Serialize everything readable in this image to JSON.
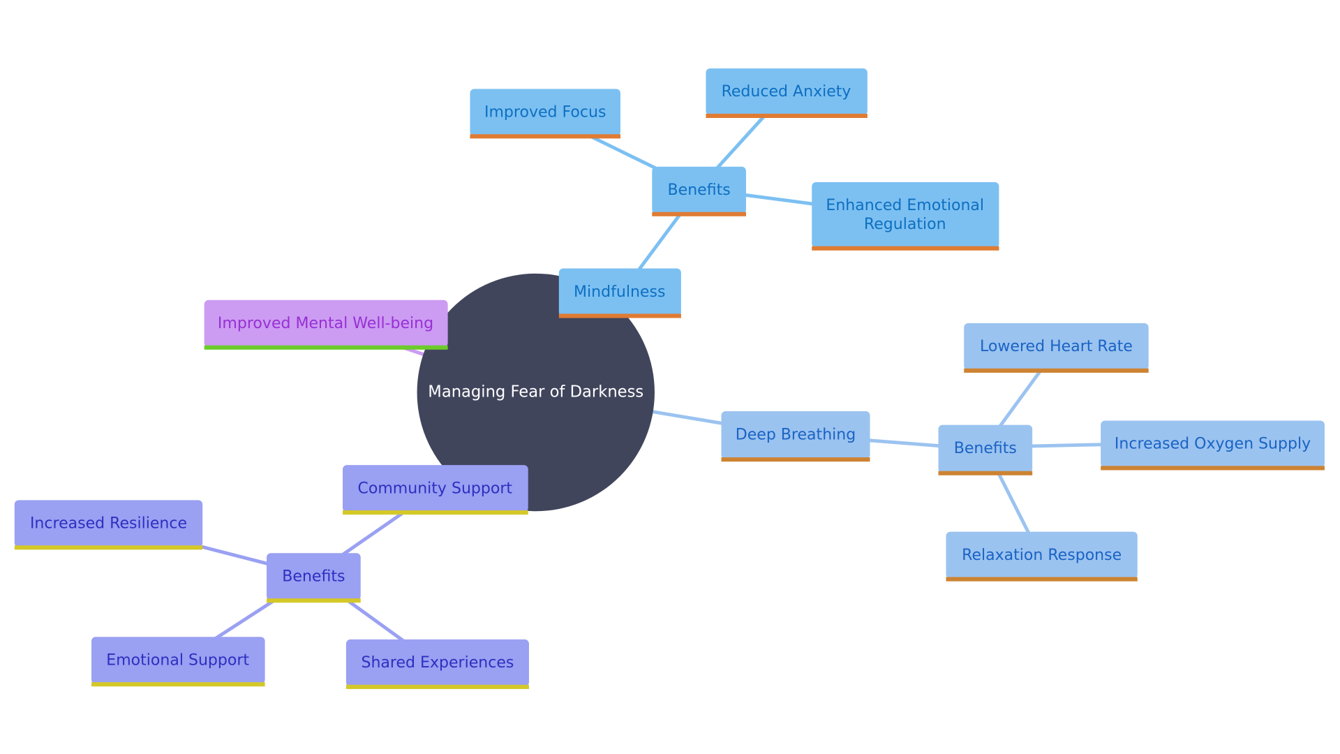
{
  "diagram": {
    "type": "mindmap",
    "root": {
      "label": "Managing Fear of Darkness",
      "color": "#40455C"
    },
    "colors": {
      "blue_fill": "#7CC0F2",
      "blue_text": "#0E6FC0",
      "blue_line": "#7CC0F2",
      "lblue_fill": "#9BC3F0",
      "lblue_text": "#1A63C4",
      "lblue_line": "#9BC3F0",
      "orange_bar": "#E07B33",
      "dorange_bar": "#CD8332",
      "violet_fill": "#9AA0F2",
      "violet_text": "#2D2FC0",
      "violet_line": "#9AA0F2",
      "yellow_bar": "#D4C829",
      "purple_fill": "#CC9BF2",
      "purple_text": "#9730D4",
      "purple_line": "#CC9BF2",
      "green_bar": "#6CCB2A"
    },
    "nodes": {
      "mindfulness": "Mindfulness",
      "mind_benefits": "Benefits",
      "improved_focus": "Improved Focus",
      "reduced_anxiety": "Reduced Anxiety",
      "emotional_regulation_1": "Enhanced Emotional",
      "emotional_regulation_2": "Regulation",
      "deep_breathing": "Deep Breathing",
      "breath_benefits": "Benefits",
      "lowered_heart_rate": "Lowered Heart Rate",
      "oxygen_supply": "Increased Oxygen Supply",
      "relaxation_response": "Relaxation Response",
      "community_support": "Community Support",
      "comm_benefits": "Benefits",
      "increased_resilience": "Increased Resilience",
      "emotional_support": "Emotional Support",
      "shared_experiences": "Shared Experiences",
      "mental_wellbeing": "Improved Mental Well-being"
    }
  }
}
